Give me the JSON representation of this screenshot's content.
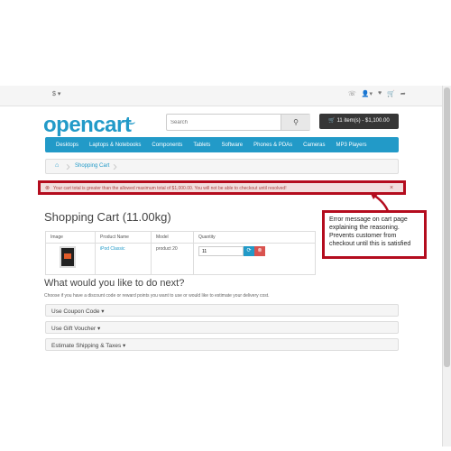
{
  "topbar": {
    "currency": "$ ▾",
    "icons": [
      "phone-icon",
      "user-icon",
      "heart-icon",
      "cart-icon",
      "share-icon"
    ]
  },
  "header": {
    "logo": "opencart",
    "search": {
      "placeholder": "Search"
    },
    "cart_button": "11 item(s) - $1,100.00"
  },
  "nav": {
    "items": [
      "Desktops",
      "Laptops & Notebooks",
      "Components",
      "Tablets",
      "Software",
      "Phones & PDAs",
      "Cameras",
      "MP3 Players"
    ]
  },
  "breadcrumb": {
    "home_icon": "home-icon",
    "current": "Shopping Cart"
  },
  "alert": {
    "message": "Your cart total is greater than the allowed maximum total of $1,000.00. You will not be able to checkout until resolved!",
    "close": "×"
  },
  "page_title": "Shopping Cart  (11.00kg)",
  "cart_table": {
    "headers": [
      "Image",
      "Product Name",
      "Model",
      "Quantity"
    ],
    "rows": [
      {
        "product_name": "iPod Classic",
        "model": "product 20",
        "quantity": "11"
      }
    ]
  },
  "callout": {
    "text": "Error message on cart page explaining the reasoning. Prevents customer from checkout until this is satisfied"
  },
  "next_section": {
    "title": "What would you like to do next?",
    "description": "Choose if you have a discount code or reward points you want to use or would like to estimate your delivery cost.",
    "panels": [
      "Use Coupon Code ▾",
      "Use Gift Voucher ▾",
      "Estimate Shipping & Taxes ▾"
    ]
  },
  "colors": {
    "brand": "#229ac8",
    "alert_border": "#b40c1e",
    "alert_bg": "#f2dede"
  }
}
